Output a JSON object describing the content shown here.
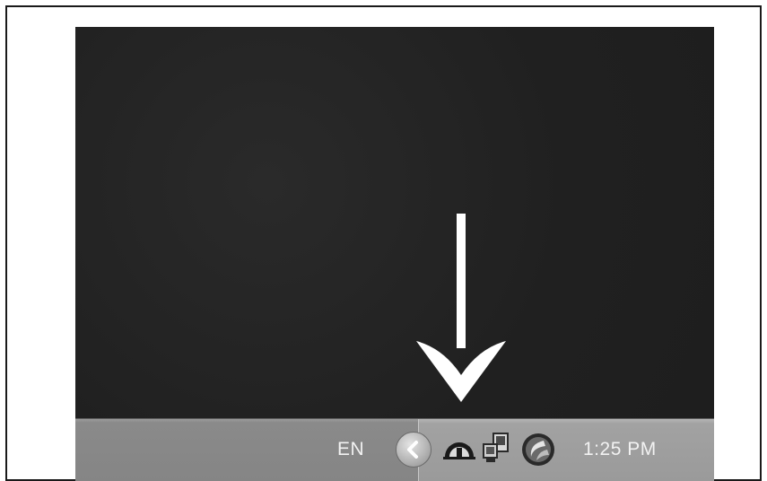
{
  "taskbar": {
    "language_indicator": "EN",
    "clock": "1:25 PM",
    "show_hidden_icons_button": "chevron-left-icon",
    "tray_icons": [
      "speedometer-icon",
      "network-computers-icon",
      "circular-logo-icon"
    ]
  },
  "desktop": {
    "annotation": "down-arrow-icon"
  },
  "colors": {
    "desktop": "#222222",
    "taskbar": "#8a8a8a",
    "tray": "#a2a2a2",
    "text": "#f2f2f2",
    "arrow": "#ffffff"
  }
}
